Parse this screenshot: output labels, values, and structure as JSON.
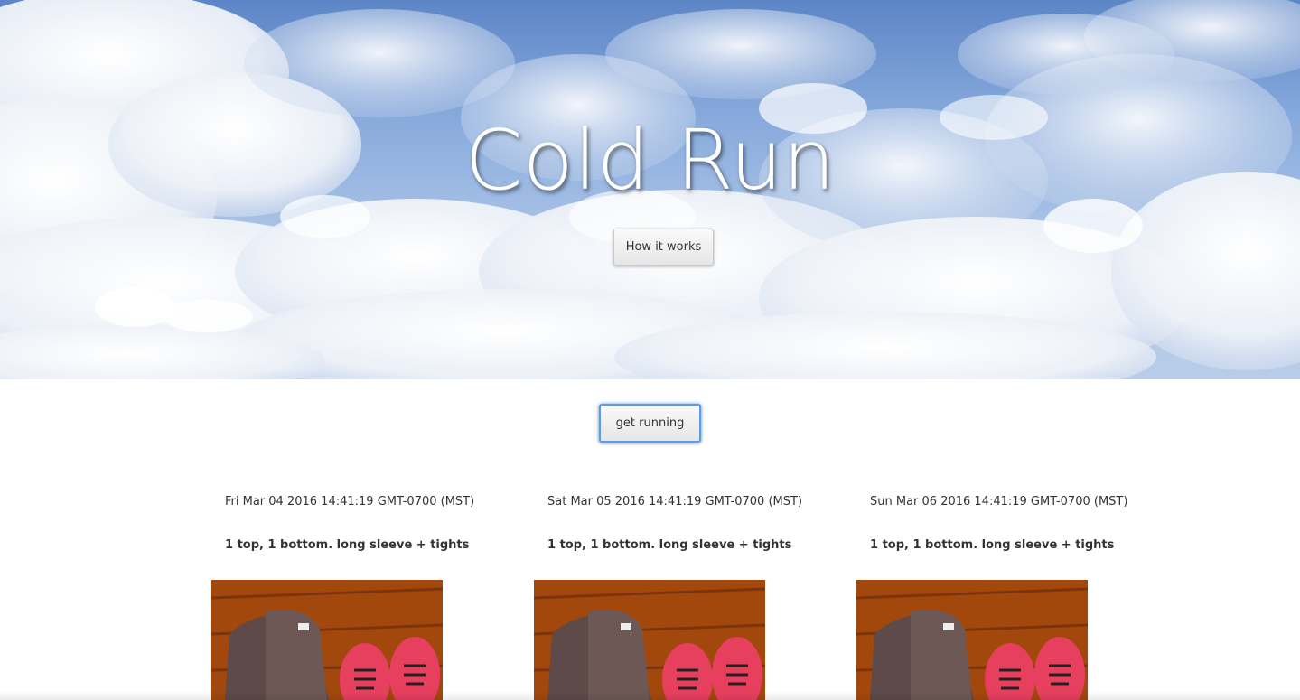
{
  "hero": {
    "title": "Cold Run",
    "how_button_label": "How it works"
  },
  "main": {
    "run_button_label": "get running"
  },
  "forecast": [
    {
      "date": "Fri Mar 04 2016 14:41:19 GMT-0700 (MST)",
      "outfit": "1 top, 1 bottom. long sleeve + tights"
    },
    {
      "date": "Sat Mar 05 2016 14:41:19 GMT-0700 (MST)",
      "outfit": "1 top, 1 bottom. long sleeve + tights"
    },
    {
      "date": "Sun Mar 06 2016 14:41:19 GMT-0700 (MST)",
      "outfit": "1 top, 1 bottom. long sleeve + tights"
    }
  ],
  "colors": {
    "sky": "#7fa3d8",
    "button_focus": "#5b9be8",
    "text": "#333333"
  }
}
